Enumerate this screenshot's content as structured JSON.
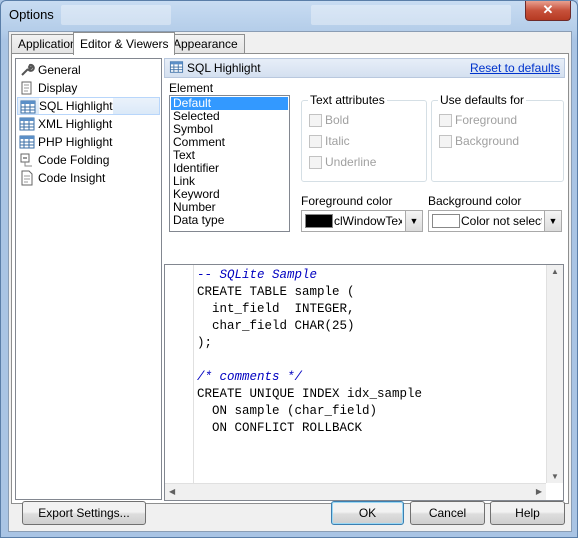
{
  "window": {
    "title": "Options",
    "close_glyph": "✕"
  },
  "tabs": [
    {
      "label": "Application"
    },
    {
      "label": "Editor & Viewers"
    },
    {
      "label": "Appearance"
    }
  ],
  "sidebar": {
    "items": [
      {
        "label": "General",
        "icon": "wrench-icon"
      },
      {
        "label": "Display",
        "icon": "display-icon"
      },
      {
        "label": "SQL Highlight",
        "icon": "grid-icon"
      },
      {
        "label": "XML Highlight",
        "icon": "grid-icon"
      },
      {
        "label": "PHP Highlight",
        "icon": "grid-icon"
      },
      {
        "label": "Code Folding",
        "icon": "code-folding-icon"
      },
      {
        "label": "Code Insight",
        "icon": "document-icon"
      }
    ],
    "selected": "SQL Highlight"
  },
  "header": {
    "title": "SQL Highlight",
    "reset_link": "Reset to defaults"
  },
  "element": {
    "label": "Element",
    "items": [
      "Default",
      "Selected",
      "Symbol",
      "Comment",
      "Text",
      "Identifier",
      "Link",
      "Keyword",
      "Number",
      "Data type"
    ],
    "selected": "Default"
  },
  "text_attributes": {
    "title": "Text attributes",
    "bold": "Bold",
    "italic": "Italic",
    "underline": "Underline"
  },
  "use_defaults": {
    "title": "Use defaults for",
    "foreground": "Foreground",
    "background": "Background"
  },
  "foreground_color": {
    "label": "Foreground color",
    "value": "clWindowText",
    "swatch": "#000000"
  },
  "background_color": {
    "label": "Background color",
    "value": "Color not selected",
    "swatch": "#ffffff"
  },
  "preview": {
    "lines": [
      {
        "text": "-- SQLite Sample",
        "style": "comment"
      },
      {
        "text": "CREATE TABLE sample (",
        "style": "normal"
      },
      {
        "text": "  int_field  INTEGER,",
        "style": "normal"
      },
      {
        "text": "  char_field CHAR(25)",
        "style": "normal"
      },
      {
        "text": ");",
        "style": "normal"
      },
      {
        "text": "",
        "style": "normal"
      },
      {
        "text": "/* comments */",
        "style": "comment"
      },
      {
        "text": "CREATE UNIQUE INDEX idx_sample",
        "style": "normal"
      },
      {
        "text": "  ON sample (char_field)",
        "style": "normal"
      },
      {
        "text": "  ON CONFLICT ROLLBACK",
        "style": "normal"
      }
    ]
  },
  "buttons": {
    "export": "Export Settings...",
    "ok": "OK",
    "cancel": "Cancel",
    "help": "Help"
  },
  "colors": {
    "accent_selection": "#3399ff",
    "link": "#0033cc",
    "comment": "#0000c0"
  }
}
